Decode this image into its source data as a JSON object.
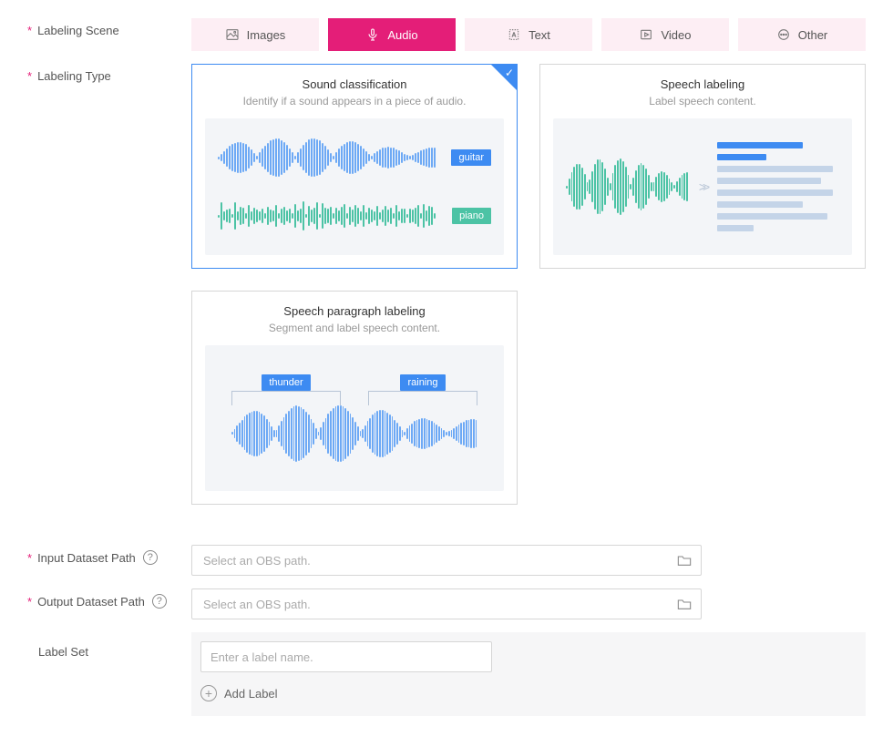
{
  "labels": {
    "labeling_scene": "Labeling Scene",
    "labeling_type": "Labeling Type",
    "input_dataset_path": "Input Dataset Path",
    "output_dataset_path": "Output Dataset Path",
    "label_set": "Label Set"
  },
  "scene_tabs": {
    "images": "Images",
    "audio": "Audio",
    "text": "Text",
    "video": "Video",
    "other": "Other"
  },
  "types": {
    "sound_classification": {
      "title": "Sound classification",
      "desc": "Identify if a sound appears in a piece of audio.",
      "tag1": "guitar",
      "tag2": "piano"
    },
    "speech_labeling": {
      "title": "Speech labeling",
      "desc": "Label speech content."
    },
    "speech_paragraph": {
      "title": "Speech paragraph labeling",
      "desc": "Segment and label speech content.",
      "tag1": "thunder",
      "tag2": "raining"
    }
  },
  "paths": {
    "input_placeholder": "Select an OBS path.",
    "output_placeholder": "Select an OBS path."
  },
  "label_set": {
    "name_placeholder": "Enter a label name.",
    "add_label": "Add Label"
  }
}
